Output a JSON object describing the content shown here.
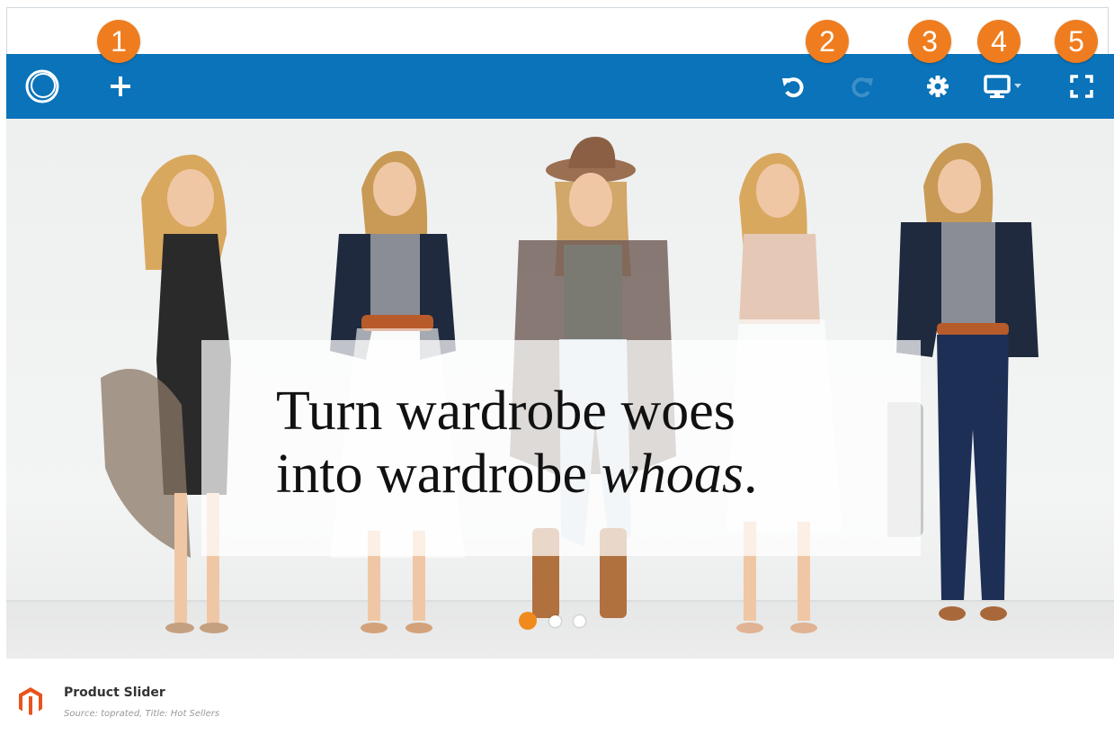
{
  "callouts": [
    "1",
    "2",
    "3",
    "4",
    "5"
  ],
  "toolbar": {
    "logo_icon": "logo-ring-icon",
    "add_icon": "plus-icon",
    "undo_icon": "undo-icon",
    "redo_icon": "redo-icon",
    "settings_icon": "gear-icon",
    "device_icon": "desktop-icon",
    "fullscreen_icon": "fullscreen-icon",
    "colors": {
      "bar": "#0a73b9",
      "icon": "#ffffff",
      "disabled_icon": "#3d8fc7"
    }
  },
  "slide": {
    "headline_line1": "Turn wardrobe woes",
    "headline_line2_pre": "into wardrobe ",
    "headline_line2_em": "whoas",
    "headline_line2_post": ".",
    "dots": {
      "count": 3,
      "active_index": 0
    },
    "colors": {
      "accent": "#f08a1c"
    }
  },
  "footer": {
    "icon": "magento-logo-icon",
    "title": "Product Slider",
    "subtitle": "Source: toprated, Title: Hot Sellers"
  },
  "colors": {
    "callout": "#ef7d1f"
  }
}
